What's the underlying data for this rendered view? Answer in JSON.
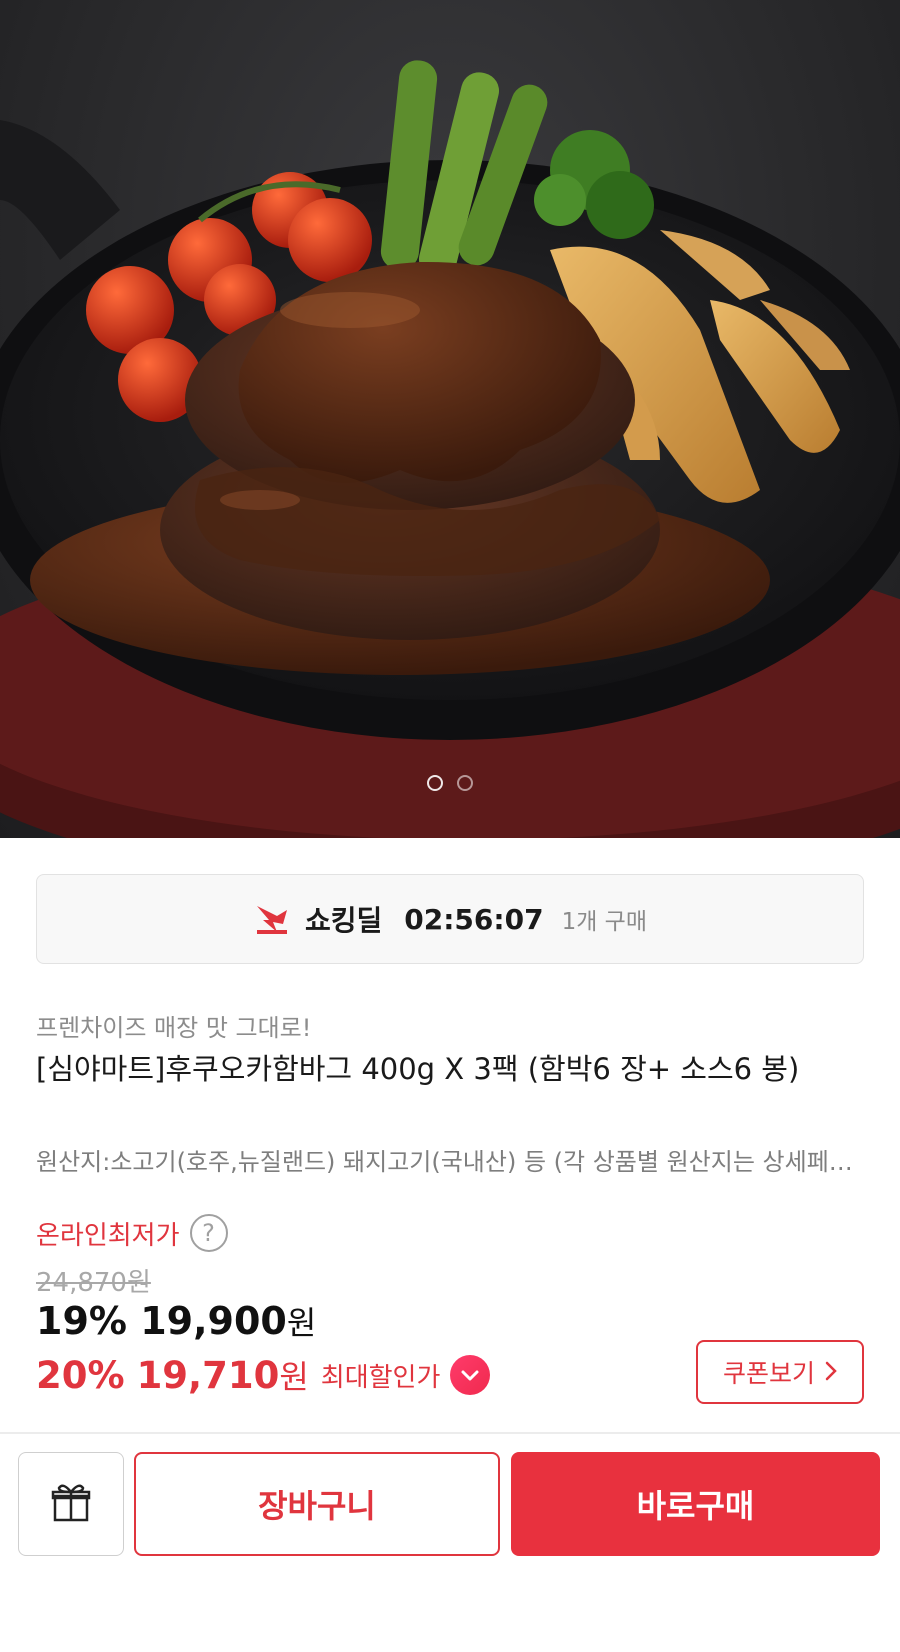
{
  "hero": {
    "image_description_icon": "hamburg-steak-photo",
    "carousel": {
      "total": 2,
      "active": 1
    }
  },
  "deal": {
    "icon": "shocking-deal-icon",
    "label": "쇼킹딜",
    "timer": "02:56:07",
    "purchase_count": "1개 구매"
  },
  "product": {
    "subtitle": "프렌차이즈 매장 맛 그대로!",
    "title": "[심야마트]후쿠오카함바그 400g X 3팩 (함박6 장+ 소스6 봉)",
    "origin": "원산지:소고기(호주,뉴질랜드) 돼지고기(국내산) 등 (각 상품별 원산지는 상세페이지 참고)"
  },
  "pricing": {
    "lowest_label": "온라인최저가",
    "help_icon": "?",
    "original_price": "24,870원",
    "discount_pct": "19%",
    "price": "19,900",
    "price_unit": "원",
    "max_discount_pct": "20%",
    "max_price": "19,710",
    "max_price_unit": "원",
    "max_label": "최대할인가",
    "coupon_label": "쿠폰보기"
  },
  "bottom_bar": {
    "gift_icon": "gift-icon",
    "cart_label": "장바구니",
    "buy_label": "바로구매"
  },
  "colors": {
    "accent": "#e0353e",
    "buy_bg": "#e8313e",
    "muted": "#8c8c8c"
  }
}
